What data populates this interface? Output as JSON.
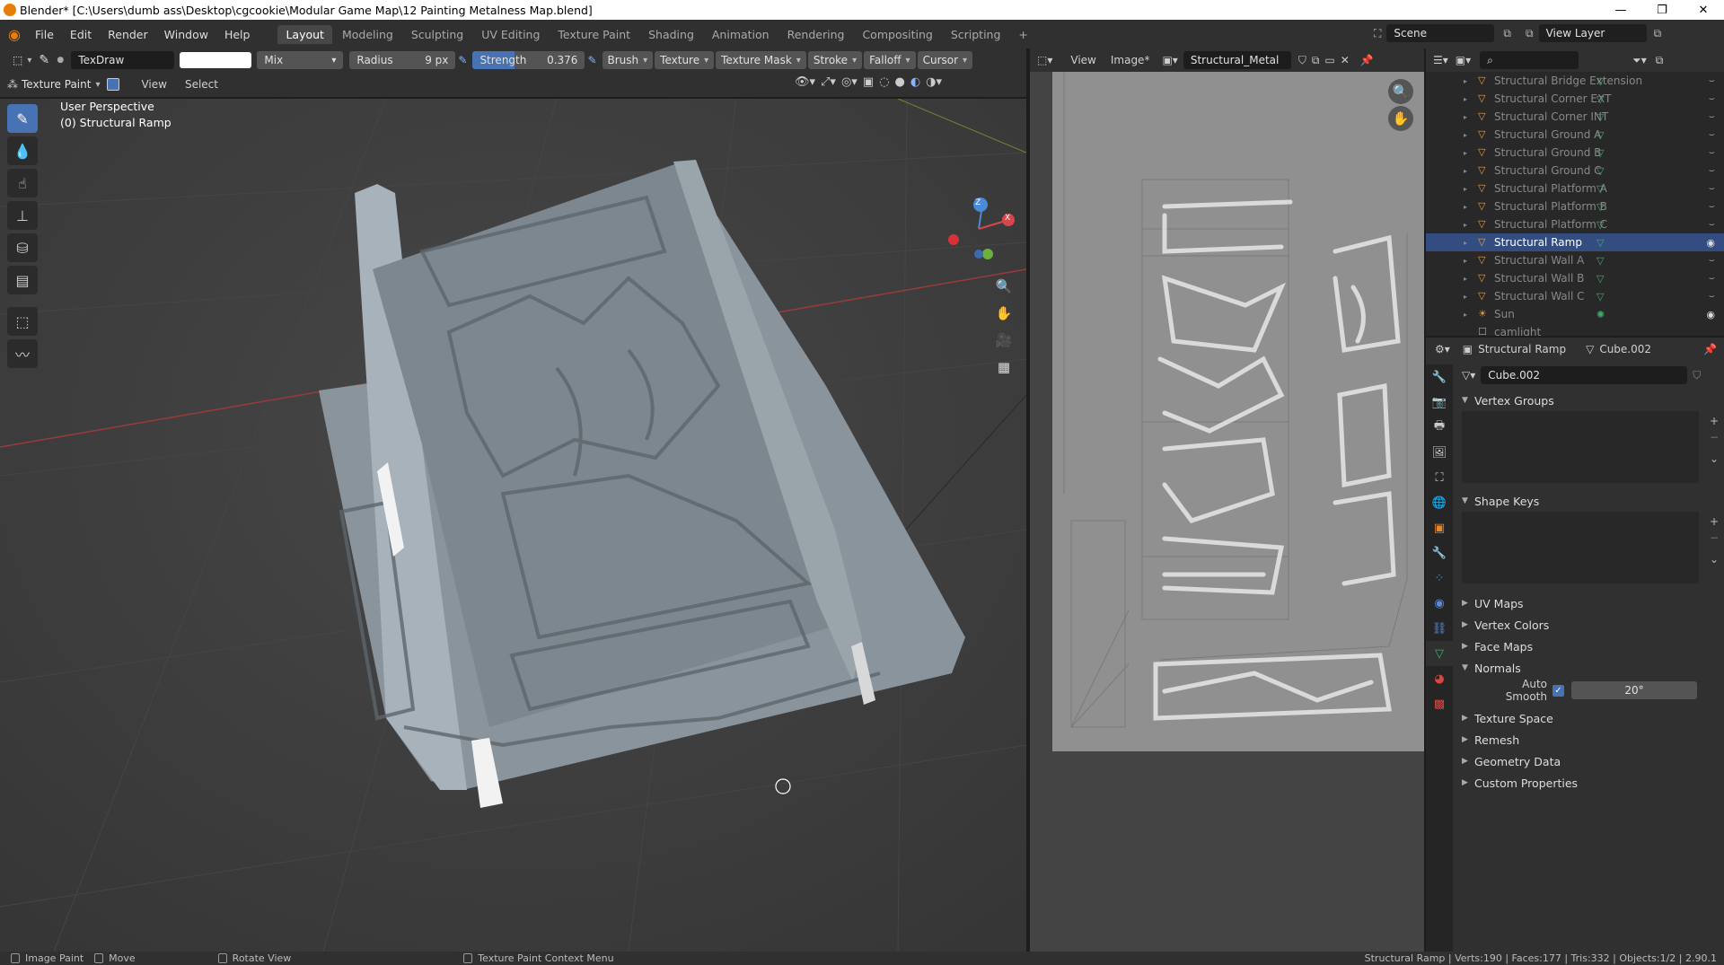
{
  "window": {
    "title": "Blender* [C:\\Users\\dumb ass\\Desktop\\cgcookie\\Modular Game Map\\12 Painting Metalness Map.blend]",
    "controls": [
      "—",
      "❐",
      "✕"
    ]
  },
  "menubar": {
    "menus": [
      "File",
      "Edit",
      "Render",
      "Window",
      "Help"
    ],
    "workspaces": [
      "Layout",
      "Modeling",
      "Sculpting",
      "UV Editing",
      "Texture Paint",
      "Shading",
      "Animation",
      "Rendering",
      "Compositing",
      "Scripting"
    ],
    "active_workspace": "Layout",
    "scene": "Scene",
    "view_layer": "View Layer"
  },
  "tool_header": {
    "brush_name": "TexDraw",
    "blend": "Mix",
    "radius_label": "Radius",
    "radius_value": "9 px",
    "strength_label": "Strength",
    "strength_value": "0.376",
    "strength_fraction": 0.376,
    "menus": [
      "Brush",
      "Texture",
      "Texture Mask",
      "Stroke",
      "Falloff",
      "Cursor"
    ],
    "color": "#ffffff"
  },
  "viewport_header": {
    "mode": "Texture Paint",
    "menus": [
      "View",
      "Select"
    ]
  },
  "viewport": {
    "perspective": "User Perspective",
    "object": "(0) Structural Ramp",
    "gizmo": {
      "z": "Z",
      "x": "X"
    }
  },
  "image_editor": {
    "menus": [
      "View",
      "Image*"
    ],
    "image_name": "Structural_Metal"
  },
  "outliner": {
    "items": [
      {
        "label": "Structural Bridge Extension",
        "selected": false,
        "type": "object"
      },
      {
        "label": "Structural Corner EXT",
        "selected": false,
        "type": "object"
      },
      {
        "label": "Structural Corner INT",
        "selected": false,
        "type": "object"
      },
      {
        "label": "Structural Ground A",
        "selected": false,
        "type": "object"
      },
      {
        "label": "Structural Ground B",
        "selected": false,
        "type": "object"
      },
      {
        "label": "Structural Ground C",
        "selected": false,
        "type": "object"
      },
      {
        "label": "Structural Platform A",
        "selected": false,
        "type": "object"
      },
      {
        "label": "Structural Platform B",
        "selected": false,
        "type": "object"
      },
      {
        "label": "Structural Platform C",
        "selected": false,
        "type": "object"
      },
      {
        "label": "Structural Ramp",
        "selected": true,
        "type": "object"
      },
      {
        "label": "Structural Wall A",
        "selected": false,
        "type": "object"
      },
      {
        "label": "Structural Wall B",
        "selected": false,
        "type": "object"
      },
      {
        "label": "Structural Wall C",
        "selected": false,
        "type": "object"
      },
      {
        "label": "Sun",
        "selected": false,
        "type": "light"
      },
      {
        "label": "camlight",
        "selected": false,
        "type": "collection"
      }
    ]
  },
  "properties": {
    "object_name": "Structural Ramp",
    "mesh_name": "Cube.002",
    "data_field": "Cube.002",
    "panels": {
      "vertex_groups": "Vertex Groups",
      "shape_keys": "Shape Keys",
      "uv_maps": "UV Maps",
      "vertex_colors": "Vertex Colors",
      "face_maps": "Face Maps",
      "normals": "Normals",
      "texture_space": "Texture Space",
      "remesh": "Remesh",
      "geometry_data": "Geometry Data",
      "custom_properties": "Custom Properties"
    },
    "auto_smooth_label": "Auto Smooth",
    "auto_smooth_angle": "20°"
  },
  "statusbar": {
    "left": [
      "Image Paint",
      "Move",
      "Rotate View",
      "Texture Paint Context Menu"
    ],
    "right": "Structural Ramp | Verts:190 | Faces:177 | Tris:332 | Objects:1/2 | 2.90.1"
  }
}
